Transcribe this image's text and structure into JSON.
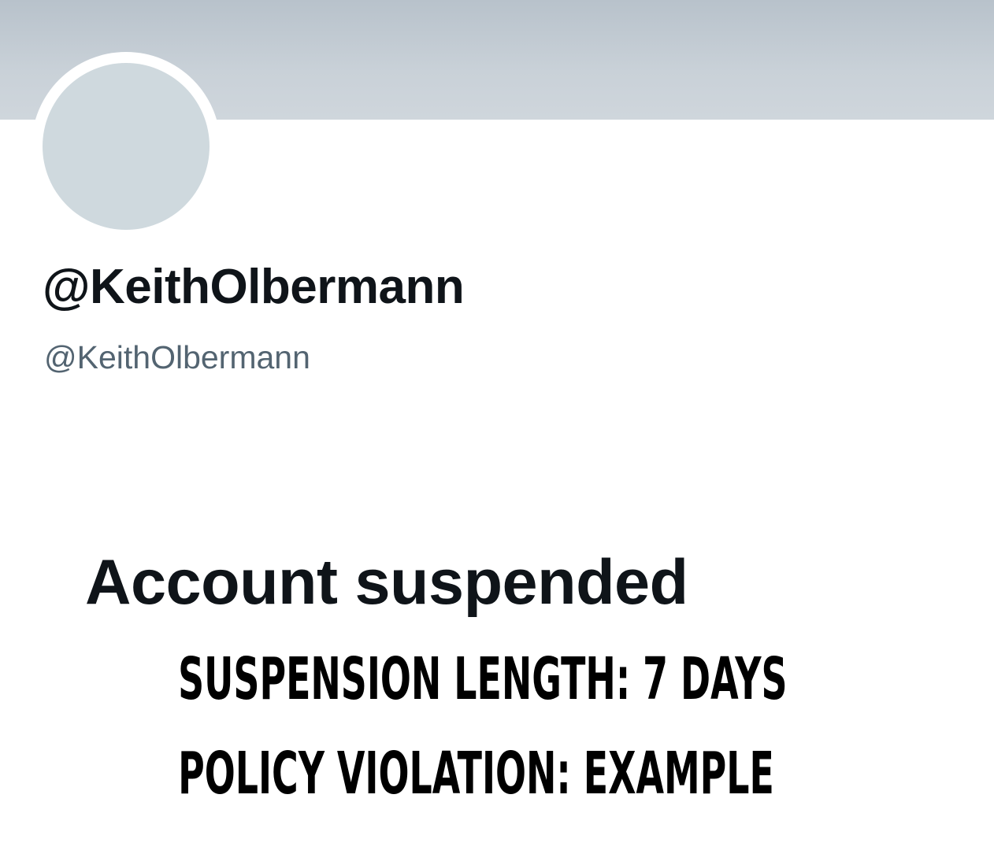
{
  "profile": {
    "display_name": "@KeithOlbermann",
    "handle": "@KeithOlbermann"
  },
  "status": {
    "title": "Account suspended"
  },
  "overlay": {
    "line1": "SUSPENSION LENGTH: 7 DAYS",
    "line2": "POLICY VIOLATION: EXAMPLE"
  },
  "colors": {
    "banner": "#c9d1d8",
    "avatar": "#cfd9de",
    "primary_text": "#0f1419",
    "secondary_text": "#536471"
  }
}
